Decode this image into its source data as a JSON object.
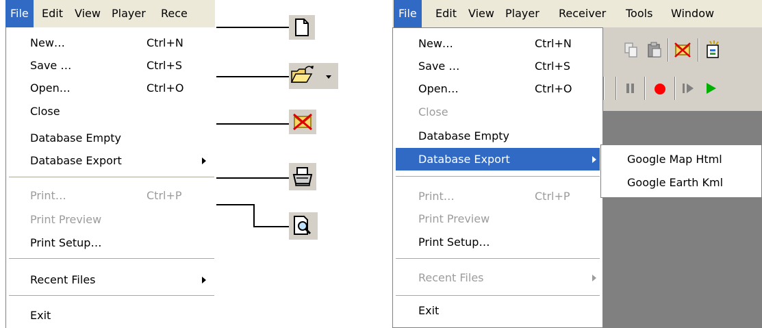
{
  "left": {
    "menubar": [
      "File",
      "Edit",
      "View",
      "Player",
      "Rece"
    ],
    "items": [
      {
        "label": "New…",
        "shortcut": "Ctrl+N",
        "disabled": false
      },
      {
        "label": "Save …",
        "shortcut": "Ctrl+S",
        "disabled": false
      },
      {
        "label": "Open…",
        "shortcut": "Ctrl+O",
        "disabled": false
      },
      {
        "label": "Close",
        "shortcut": "",
        "disabled": false
      },
      {
        "label": "Database Empty",
        "shortcut": "",
        "disabled": false
      },
      {
        "label": "Database Export",
        "shortcut": "",
        "disabled": false,
        "submenu": true
      },
      {
        "label": "Print…",
        "shortcut": "Ctrl+P",
        "disabled": true
      },
      {
        "label": "Print Preview",
        "shortcut": "",
        "disabled": true
      },
      {
        "label": "Print Setup…",
        "shortcut": "",
        "disabled": false
      },
      {
        "label": "Recent Files",
        "shortcut": "",
        "disabled": false,
        "submenu": true
      },
      {
        "label": "Exit",
        "shortcut": "",
        "disabled": false
      }
    ]
  },
  "right": {
    "menubar": [
      "File",
      "Edit",
      "View",
      "Player",
      "Receiver",
      "Tools",
      "Window"
    ],
    "items": [
      {
        "label": "New…",
        "shortcut": "Ctrl+N",
        "disabled": false
      },
      {
        "label": "Save …",
        "shortcut": "Ctrl+S",
        "disabled": false
      },
      {
        "label": "Open…",
        "shortcut": "Ctrl+O",
        "disabled": false
      },
      {
        "label": "Close",
        "shortcut": "",
        "disabled": true
      },
      {
        "label": "Database Empty",
        "shortcut": "",
        "disabled": false
      },
      {
        "label": "Database Export",
        "shortcut": "",
        "disabled": false,
        "submenu": true,
        "highlighted": true
      },
      {
        "label": "Print…",
        "shortcut": "Ctrl+P",
        "disabled": true
      },
      {
        "label": "Print Preview",
        "shortcut": "",
        "disabled": true
      },
      {
        "label": "Print Setup…",
        "shortcut": "",
        "disabled": false
      },
      {
        "label": "Recent Files",
        "shortcut": "",
        "disabled": true,
        "submenu": true
      },
      {
        "label": "Exit",
        "shortcut": "",
        "disabled": false
      }
    ],
    "submenu": [
      "Google Map Html",
      "Google Earth Kml"
    ]
  },
  "icons": [
    "new-document-icon",
    "open-folder-icon",
    "close-database-icon",
    "print-icon",
    "print-preview-icon"
  ],
  "colors": {
    "highlight": "#316ac5",
    "menubar": "#ece9d8",
    "toolbar": "#d4d0c8",
    "workspace": "#808080",
    "disabled": "#9c9c9c",
    "record": "#ff0000",
    "play": "#00b000"
  }
}
